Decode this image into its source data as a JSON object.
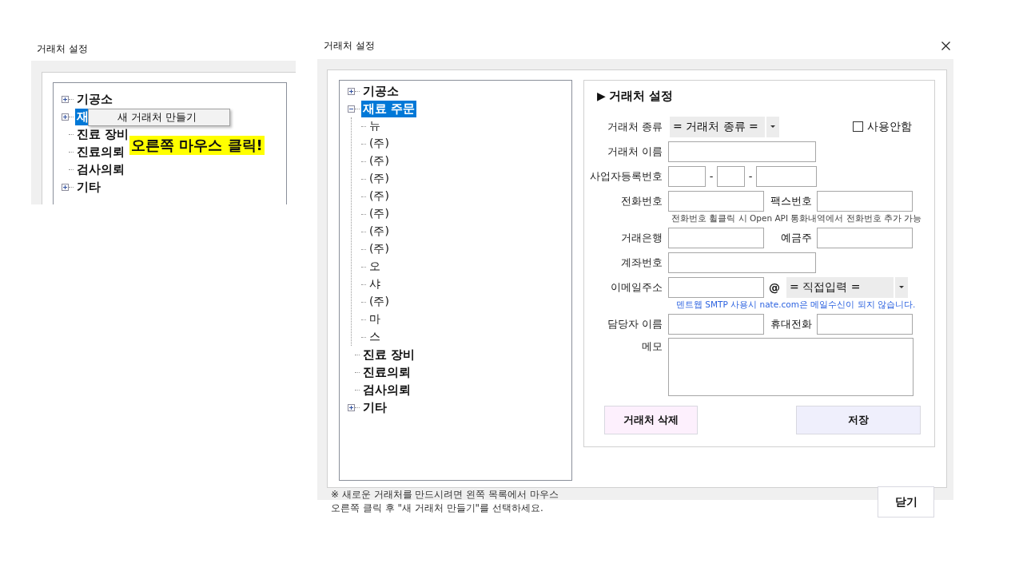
{
  "left_window": {
    "title": "거래처 설정",
    "tree": [
      {
        "label": "기공소",
        "expanded": false,
        "selected": false
      },
      {
        "label": "재",
        "expanded": false,
        "selected": true
      },
      {
        "label": "진료 장비",
        "selected": false
      },
      {
        "label": "진료의뢰",
        "selected": false
      },
      {
        "label": "검사의뢰",
        "selected": false
      },
      {
        "label": "기타",
        "expanded": false,
        "selected": false
      }
    ],
    "context_menu": {
      "items": [
        "새 거래처 만들기"
      ]
    },
    "callout": "오른쪽 마우스 클릭!"
  },
  "main_window": {
    "title": "거래처 설정",
    "tree": [
      {
        "label": "기공소",
        "expanded": false,
        "selected": false
      },
      {
        "label": "재료 주문",
        "expanded": true,
        "selected": true,
        "children": [
          {
            "label": "뉴",
            "selected": false
          },
          {
            "label": "(주)",
            "selected": false
          },
          {
            "label": "(주)",
            "selected": false
          },
          {
            "label": "(주)",
            "selected": false
          },
          {
            "label": "(주)",
            "selected": false
          },
          {
            "label": "(주)",
            "selected": false
          },
          {
            "label": "(주)",
            "selected": false
          },
          {
            "label": "(주)",
            "selected": false
          },
          {
            "label": "오",
            "selected": false
          },
          {
            "label": "샤",
            "selected": false
          },
          {
            "label": "(주)",
            "selected": false
          },
          {
            "label": "마",
            "selected": false
          },
          {
            "label": "스",
            "selected": false
          }
        ]
      },
      {
        "label": "진료 장비",
        "selected": false
      },
      {
        "label": "진료의뢰",
        "selected": false
      },
      {
        "label": "검사의뢰",
        "selected": false
      },
      {
        "label": "기타",
        "expanded": false,
        "selected": false
      }
    ],
    "form": {
      "section_marker": "▶",
      "section_title": "거래처 설정",
      "type": {
        "label": "거래처 종류",
        "value": "= 거래처 종류 ="
      },
      "unused": {
        "label": "사용안함",
        "checked": false
      },
      "name": {
        "label": "거래처 이름"
      },
      "business_number": {
        "label": "사업자등록번호",
        "separators": [
          "-",
          "-"
        ]
      },
      "phone": {
        "label": "전화번호"
      },
      "fax": {
        "label": "팩스번호"
      },
      "phone_hint": "전화번호 휠클릭 시 Open API 통화내역에서 전화번호 추가 가능",
      "bank": {
        "label": "거래은행"
      },
      "holder": {
        "label": "예금주"
      },
      "account": {
        "label": "계좌번호"
      },
      "email": {
        "label": "이메일주소",
        "at": "@",
        "domain": "= 직접입력 ="
      },
      "email_hint": "덴트웹 SMTP 사용시 nate.com은 메일수신이 되지 않습니다.",
      "contact": {
        "label": "담당자 이름"
      },
      "mobile": {
        "label": "휴대전화"
      },
      "memo": {
        "label": "메모"
      },
      "buttons": {
        "delete": "거래처 삭제",
        "save": "저장"
      }
    },
    "note": "※ 새로운 거래처를 만드시려면 왼쪽 목록에서 마우스\n오른쪽 클릭 후 \"새 거래처 만들기\"를 선택하세요.",
    "close_button": "닫기"
  }
}
